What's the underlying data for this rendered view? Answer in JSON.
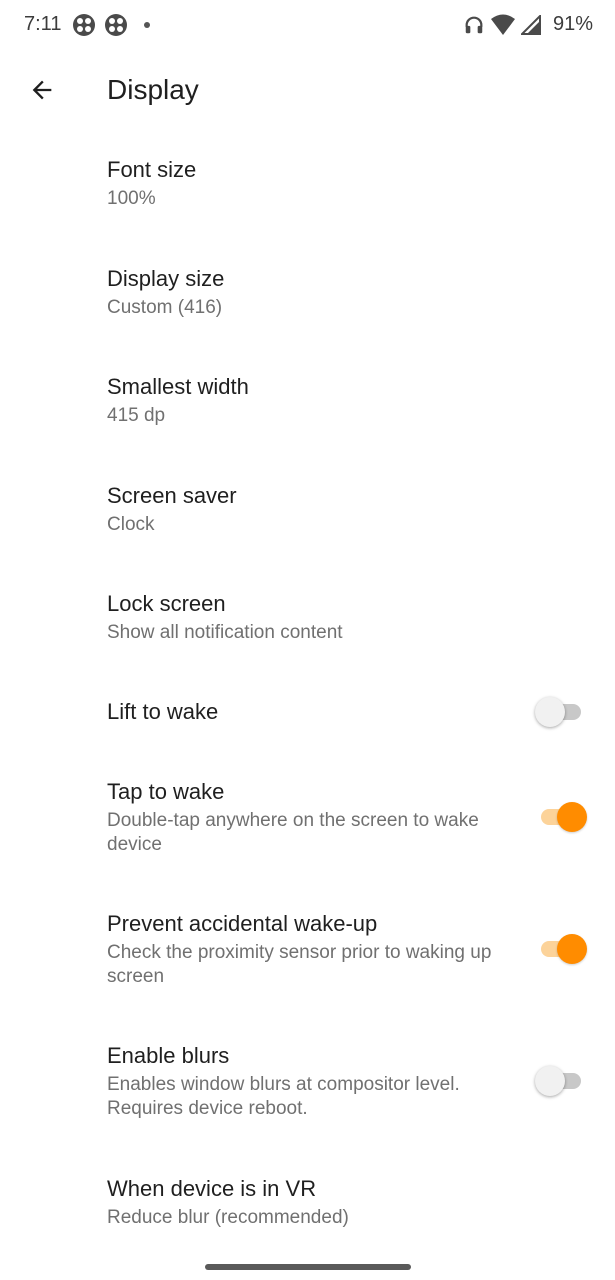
{
  "status_bar": {
    "time": "7:11",
    "battery": "91%",
    "icons": [
      "app-notification-icon",
      "app-notification-icon",
      "notification-dot",
      "headphones-icon",
      "wifi-icon",
      "signal-icon"
    ]
  },
  "app_bar": {
    "title": "Display",
    "back_icon": "arrow-back-icon"
  },
  "settings": [
    {
      "title": "Font size",
      "summary": "100%"
    },
    {
      "title": "Display size",
      "summary": "Custom (416)"
    },
    {
      "title": "Smallest width",
      "summary": "415 dp"
    },
    {
      "title": "Screen saver",
      "summary": "Clock"
    },
    {
      "title": "Lock screen",
      "summary": "Show all notification content"
    },
    {
      "title": "Lift to wake",
      "summary": "",
      "toggle": "off"
    },
    {
      "title": "Tap to wake",
      "summary": "Double-tap anywhere on the screen to wake device",
      "toggle": "on"
    },
    {
      "title": "Prevent accidental wake-up",
      "summary": "Check the proximity sensor prior to waking up screen",
      "toggle": "on"
    },
    {
      "title": "Enable blurs",
      "summary": "Enables window blurs at compositor level. Requires device reboot.",
      "toggle": "off"
    },
    {
      "title": "When device is in VR",
      "summary": "Reduce blur (recommended)"
    }
  ],
  "colors": {
    "accent": "#ff8c00",
    "accent_track": "#fcd39a",
    "text_primary": "#1f1f1f",
    "text_secondary": "#707070"
  }
}
